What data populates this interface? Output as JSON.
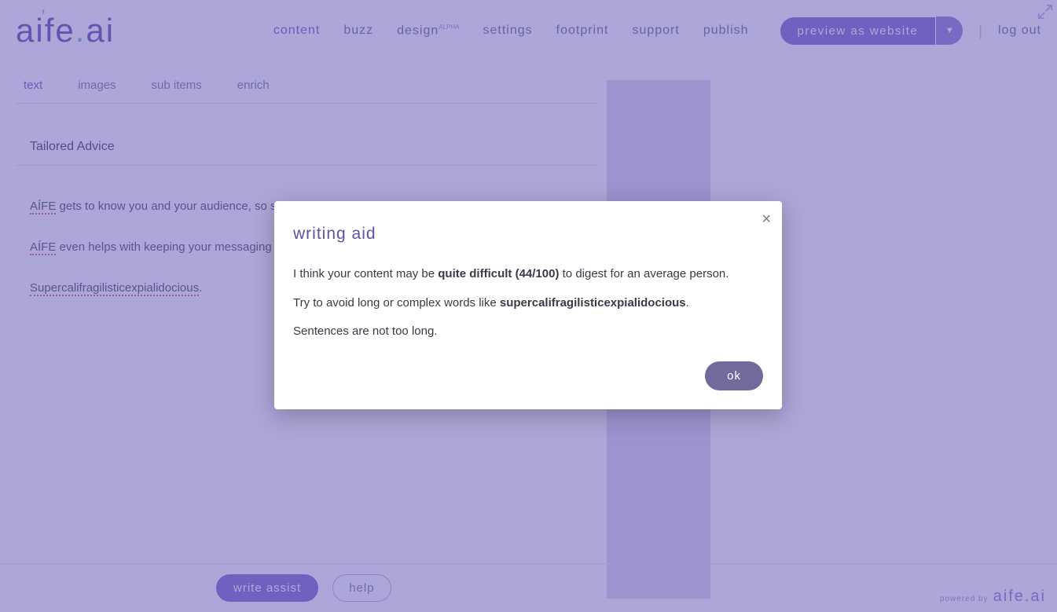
{
  "brand": {
    "text": "aife.ai",
    "powered_label": "powered by",
    "powered_brand": "aife.ai"
  },
  "nav": {
    "content": "content",
    "buzz": "buzz",
    "design": "design",
    "design_sup": "ALPHA",
    "settings": "settings",
    "footprint": "footprint",
    "support": "support",
    "publish": "publish",
    "preview": "preview as website",
    "preview_caret": "▼",
    "separator": "|",
    "logout": "log out"
  },
  "subtabs": {
    "text": "text",
    "images": "images",
    "subitems": "sub items",
    "enrich": "enrich"
  },
  "editor": {
    "title_value": "Tailored Advice",
    "p1a": "AÍFE",
    "p1b": " gets to know you and your audience, so she",
    "p2a": "AÍFE",
    "p2b": " even helps with keeping your messaging cor",
    "p3a": "Supercalifragilisticexpialidocious",
    "p3b": "."
  },
  "bottom": {
    "write": "write assist",
    "help": "help"
  },
  "modal": {
    "title": "writing aid",
    "line1_pre": "I think your content may be ",
    "line1_bold": "quite difficult (44/100)",
    "line1_post": " to digest for an average person.",
    "line2_pre": "Try to avoid long or complex words like ",
    "line2_bold": "supercalifragilisticexpialidocious",
    "line2_post": ".",
    "line3": "Sentences are not too long.",
    "ok": "ok",
    "close": "×"
  }
}
